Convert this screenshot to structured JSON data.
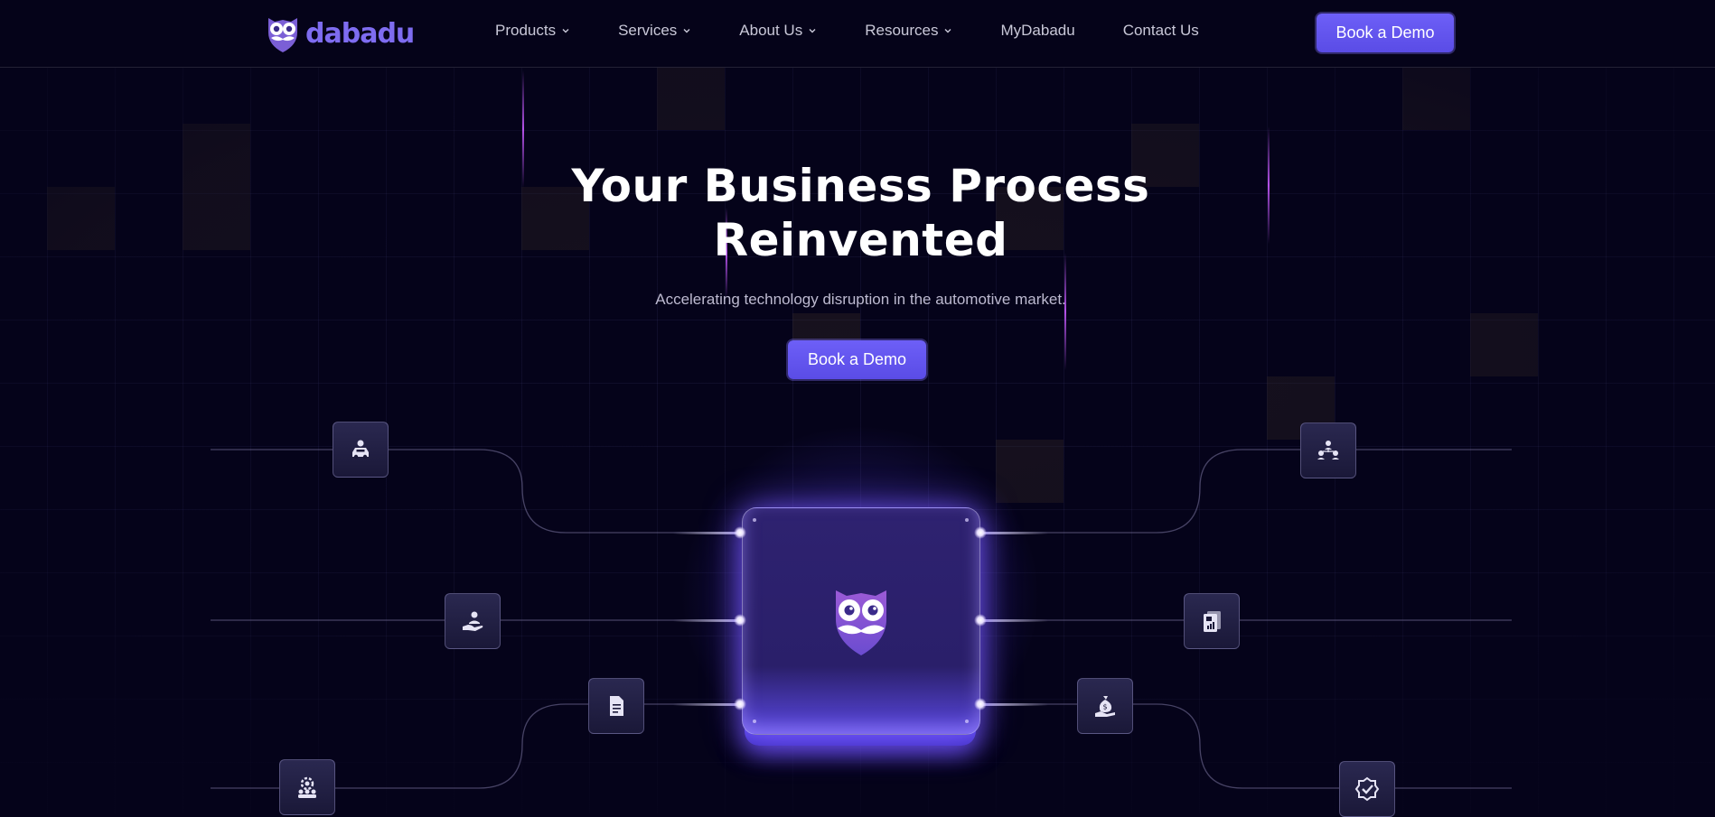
{
  "brand": {
    "name": "dabadu"
  },
  "nav": {
    "items": [
      {
        "label": "Products",
        "has_dropdown": true
      },
      {
        "label": "Services",
        "has_dropdown": true
      },
      {
        "label": "About Us",
        "has_dropdown": true
      },
      {
        "label": "Resources",
        "has_dropdown": true
      },
      {
        "label": "MyDabadu",
        "has_dropdown": false
      },
      {
        "label": "Contact Us",
        "has_dropdown": false
      }
    ],
    "cta_label": "Book a Demo"
  },
  "hero": {
    "title_line1": "Your Business Process",
    "title_line2": "Reinvented",
    "subtitle": "Accelerating technology disruption in the automotive market.",
    "cta_label": "Book a Demo"
  },
  "diagram": {
    "core_icon": "owl-logo-icon",
    "left_nodes": [
      "car-service-icon",
      "hand-user-icon",
      "document-icon",
      "team-gear-icon"
    ],
    "right_nodes": [
      "org-chart-icon",
      "report-chart-icon",
      "money-bag-hand-icon",
      "badge-check-icon"
    ]
  },
  "colors": {
    "background": "#05031a",
    "accent": "#6d5ff7",
    "brand": "#7e6cf0",
    "core": "#2e2270"
  }
}
